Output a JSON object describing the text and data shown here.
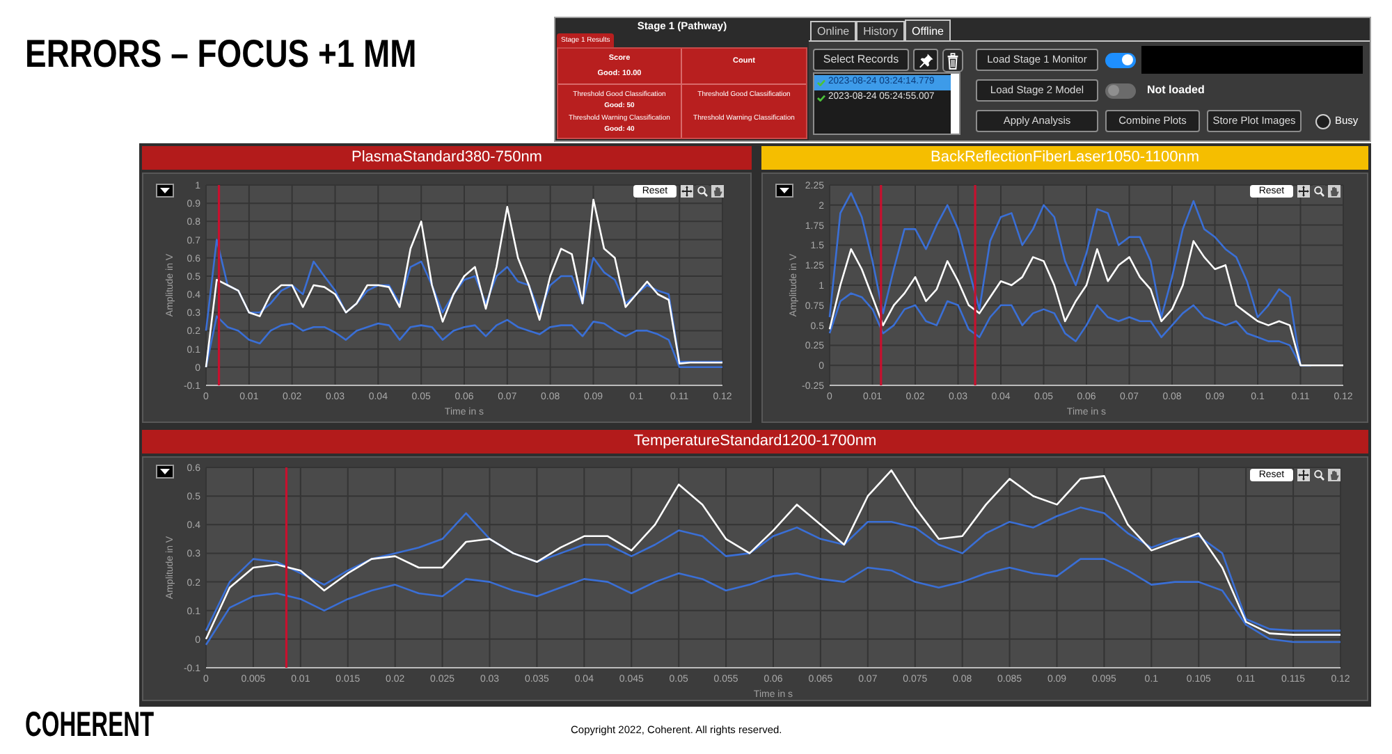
{
  "slide": {
    "title": "ERRORS – FOCUS +1 MM"
  },
  "app": {
    "stage": {
      "title": "Stage 1 (Pathway)",
      "tab": "Stage 1 Results",
      "columns": [
        {
          "heading": "Score",
          "value": "Good: 10.00",
          "thresholds": [
            {
              "label": "Threshold Good Classification",
              "value": "Good: 50"
            },
            {
              "label": "Threshold Warning Classification",
              "value": "Good: 40"
            }
          ]
        },
        {
          "heading": "Count",
          "thresholds": [
            {
              "label": "Threshold Good Classification"
            },
            {
              "label": "Threshold Warning Classification"
            }
          ]
        }
      ]
    },
    "tabs": [
      {
        "label": "Online",
        "selected": false
      },
      {
        "label": "History",
        "selected": false
      },
      {
        "label": "Offline",
        "selected": true
      }
    ],
    "select_records": "Select Records",
    "records": [
      {
        "label": "2023-08-24 03:24:14.779",
        "checked": true,
        "selected": true
      },
      {
        "label": "2023-08-24 05:24:55.007",
        "checked": true,
        "selected": false
      }
    ],
    "rows": [
      {
        "button": "Load Stage 1 Monitor",
        "on": true,
        "kind": "display"
      },
      {
        "button": "Load Stage 2 Model",
        "on": false,
        "kind": "status",
        "status": "Not loaded"
      }
    ],
    "actions": [
      "Apply Analysis",
      "Combine Plots",
      "Store Plot Images"
    ],
    "busy": {
      "label": "Busy",
      "on": false
    }
  },
  "panels": [
    {
      "title": "PlasmaStandard380-750nm",
      "color": "#b31b1b",
      "reset": "Reset",
      "chart_data": {
        "type": "line",
        "xlabel": "Time in s",
        "ylabel": "Amplitude in V",
        "grid": true,
        "xlim": [
          0,
          0.12
        ],
        "ylim": [
          -0.1,
          1
        ],
        "xticks": [
          0,
          0.01,
          0.02,
          0.03,
          0.04,
          0.05,
          0.06,
          0.07,
          0.08,
          0.09,
          0.1,
          0.11,
          0.12
        ],
        "yticks": [
          -0.1,
          0,
          0.1,
          0.2,
          0.3,
          0.4,
          0.5,
          0.6,
          0.7,
          0.8,
          0.9,
          1
        ],
        "x": [
          0,
          0.0025,
          0.005,
          0.0075,
          0.01,
          0.0125,
          0.015,
          0.0175,
          0.02,
          0.0225,
          0.025,
          0.0275,
          0.03,
          0.0325,
          0.035,
          0.0375,
          0.04,
          0.0425,
          0.045,
          0.0475,
          0.05,
          0.0525,
          0.055,
          0.0575,
          0.06,
          0.0625,
          0.065,
          0.0675,
          0.07,
          0.0725,
          0.075,
          0.0775,
          0.08,
          0.0825,
          0.085,
          0.0875,
          0.09,
          0.0925,
          0.095,
          0.0975,
          0.1,
          0.1025,
          0.105,
          0.1075,
          0.11,
          0.1125,
          0.115,
          0.1175,
          0.12
        ],
        "series": [
          {
            "color": "#3a6fd6",
            "values": [
              0.2,
              0.7,
              0.45,
              0.42,
              0.3,
              0.3,
              0.35,
              0.42,
              0.45,
              0.4,
              0.58,
              0.5,
              0.42,
              0.3,
              0.35,
              0.42,
              0.45,
              0.45,
              0.35,
              0.55,
              0.58,
              0.45,
              0.3,
              0.4,
              0.48,
              0.5,
              0.35,
              0.5,
              0.55,
              0.47,
              0.45,
              0.3,
              0.45,
              0.5,
              0.5,
              0.35,
              0.6,
              0.52,
              0.48,
              0.35,
              0.4,
              0.45,
              0.42,
              0.4,
              0.03,
              0.03,
              0.03,
              0.03,
              0.03
            ]
          },
          {
            "color": "#3a6fd6",
            "values": [
              0,
              0.28,
              0.22,
              0.2,
              0.15,
              0.13,
              0.2,
              0.23,
              0.24,
              0.2,
              0.22,
              0.22,
              0.19,
              0.15,
              0.2,
              0.22,
              0.24,
              0.23,
              0.15,
              0.22,
              0.23,
              0.22,
              0.15,
              0.2,
              0.22,
              0.23,
              0.17,
              0.23,
              0.26,
              0.22,
              0.2,
              0.18,
              0.22,
              0.23,
              0.23,
              0.17,
              0.25,
              0.24,
              0.2,
              0.17,
              0.2,
              0.2,
              0.18,
              0.15,
              0,
              0,
              0,
              0,
              0
            ]
          },
          {
            "color": "#ffffff",
            "values": [
              0,
              0.48,
              0.45,
              0.42,
              0.3,
              0.28,
              0.4,
              0.45,
              0.45,
              0.33,
              0.45,
              0.44,
              0.4,
              0.3,
              0.35,
              0.45,
              0.45,
              0.44,
              0.33,
              0.65,
              0.8,
              0.45,
              0.25,
              0.4,
              0.5,
              0.55,
              0.32,
              0.55,
              0.88,
              0.6,
              0.45,
              0.26,
              0.5,
              0.65,
              0.62,
              0.35,
              0.92,
              0.65,
              0.6,
              0.33,
              0.4,
              0.47,
              0.4,
              0.37,
              0.02,
              0.025,
              0.025,
              0.025,
              0.025
            ]
          }
        ],
        "ref_lines": [
          {
            "axis": "x",
            "value": 0.003,
            "color": "#c8102e"
          }
        ]
      }
    },
    {
      "title": "BackReflectionFiberLaser1050-1100nm",
      "color": "#f5be00",
      "reset": "Reset",
      "chart_data": {
        "type": "line",
        "xlabel": "Time in s",
        "ylabel": "Amplitude in V",
        "grid": true,
        "xlim": [
          0,
          0.12
        ],
        "ylim": [
          -0.25,
          2.25
        ],
        "xticks": [
          0,
          0.01,
          0.02,
          0.03,
          0.04,
          0.05,
          0.06,
          0.07,
          0.08,
          0.09,
          0.1,
          0.11,
          0.12
        ],
        "yticks": [
          -0.25,
          0,
          0.25,
          0.5,
          0.75,
          1,
          1.25,
          1.5,
          1.75,
          2,
          2.25
        ],
        "x": [
          0,
          0.0025,
          0.005,
          0.0075,
          0.01,
          0.0125,
          0.015,
          0.0175,
          0.02,
          0.0225,
          0.025,
          0.0275,
          0.03,
          0.0325,
          0.035,
          0.0375,
          0.04,
          0.0425,
          0.045,
          0.0475,
          0.05,
          0.0525,
          0.055,
          0.0575,
          0.06,
          0.0625,
          0.065,
          0.0675,
          0.07,
          0.0725,
          0.075,
          0.0775,
          0.08,
          0.0825,
          0.085,
          0.0875,
          0.09,
          0.0925,
          0.095,
          0.0975,
          0.1,
          0.1025,
          0.105,
          0.1075,
          0.11,
          0.1125,
          0.115,
          0.1175,
          0.12
        ],
        "series": [
          {
            "color": "#3a6fd6",
            "values": [
              0.6,
              1.9,
              2.15,
              1.85,
              1.3,
              0.65,
              1.2,
              1.7,
              1.7,
              1.45,
              1.75,
              2.0,
              1.7,
              1.2,
              0.7,
              1.55,
              1.85,
              1.9,
              1.5,
              1.7,
              2.0,
              1.85,
              1.3,
              1.0,
              1.4,
              1.95,
              1.9,
              1.5,
              1.6,
              1.6,
              1.3,
              0.6,
              1.1,
              1.7,
              2.05,
              1.7,
              1.6,
              1.45,
              1.35,
              1.05,
              0.6,
              0.75,
              0.95,
              0.85,
              0,
              0,
              null,
              null,
              null
            ]
          },
          {
            "color": "#3a6fd6",
            "values": [
              0.4,
              0.8,
              0.9,
              0.85,
              0.7,
              0.4,
              0.5,
              0.7,
              0.75,
              0.55,
              0.5,
              0.8,
              0.75,
              0.45,
              0.35,
              0.6,
              0.75,
              0.75,
              0.5,
              0.65,
              0.7,
              0.65,
              0.4,
              0.3,
              0.5,
              0.75,
              0.6,
              0.55,
              0.6,
              0.55,
              0.55,
              0.35,
              0.5,
              0.65,
              0.75,
              0.6,
              0.55,
              0.5,
              0.55,
              0.4,
              0.35,
              0.3,
              0.3,
              0.25,
              0,
              0,
              null,
              null,
              null
            ]
          },
          {
            "color": "#ffffff",
            "values": [
              0.45,
              1.0,
              1.45,
              1.2,
              0.85,
              0.5,
              0.75,
              0.9,
              1.1,
              0.8,
              0.95,
              1.3,
              1.05,
              0.75,
              0.65,
              0.85,
              1.05,
              1.0,
              1.1,
              1.35,
              1.3,
              1.0,
              0.55,
              0.8,
              1.0,
              1.45,
              1.05,
              1.25,
              1.35,
              1.1,
              0.95,
              0.55,
              0.7,
              1.0,
              1.55,
              1.35,
              1.2,
              1.25,
              0.75,
              0.65,
              0.55,
              0.5,
              0.55,
              0.5,
              0,
              0,
              0,
              0,
              0
            ]
          }
        ],
        "ref_lines": [
          {
            "axis": "x",
            "value": 0.012,
            "color": "#c8102e"
          },
          {
            "axis": "x",
            "value": 0.034,
            "color": "#c8102e"
          }
        ]
      }
    },
    {
      "title": "TemperatureStandard1200-1700nm",
      "color": "#b31b1b",
      "reset": "Reset",
      "chart_data": {
        "type": "line",
        "xlabel": "Time in s",
        "ylabel": "Amplitude in V",
        "grid": true,
        "xlim": [
          0,
          0.12
        ],
        "ylim": [
          -0.1,
          0.6
        ],
        "xticks": [
          0,
          0.005,
          0.01,
          0.015,
          0.02,
          0.025,
          0.03,
          0.035,
          0.04,
          0.045,
          0.05,
          0.055,
          0.06,
          0.065,
          0.07,
          0.075,
          0.08,
          0.085,
          0.09,
          0.095,
          0.1,
          0.105,
          0.11,
          0.115,
          0.12
        ],
        "yticks": [
          -0.1,
          0,
          0.1,
          0.2,
          0.3,
          0.4,
          0.5,
          0.6
        ],
        "x": [
          0,
          0.0025,
          0.005,
          0.0075,
          0.01,
          0.0125,
          0.015,
          0.0175,
          0.02,
          0.0225,
          0.025,
          0.0275,
          0.03,
          0.0325,
          0.035,
          0.0375,
          0.04,
          0.0425,
          0.045,
          0.0475,
          0.05,
          0.0525,
          0.055,
          0.0575,
          0.06,
          0.0625,
          0.065,
          0.0675,
          0.07,
          0.0725,
          0.075,
          0.0775,
          0.08,
          0.0825,
          0.085,
          0.0875,
          0.09,
          0.0925,
          0.095,
          0.0975,
          0.1,
          0.1025,
          0.105,
          0.1075,
          0.11,
          0.1125,
          0.115,
          0.1175,
          0.12
        ],
        "series": [
          {
            "color": "#3a6fd6",
            "values": [
              0.03,
              0.2,
              0.28,
              0.27,
              0.23,
              0.19,
              0.24,
              0.28,
              0.3,
              0.32,
              0.35,
              0.44,
              0.35,
              0.3,
              0.27,
              0.3,
              0.33,
              0.33,
              0.29,
              0.33,
              0.38,
              0.36,
              0.29,
              0.3,
              0.36,
              0.39,
              0.35,
              0.33,
              0.41,
              0.41,
              0.39,
              0.33,
              0.3,
              0.37,
              0.41,
              0.39,
              0.43,
              0.46,
              0.44,
              0.37,
              0.32,
              0.35,
              0.36,
              0.3,
              0.07,
              0.035,
              0.03,
              0.03,
              0.03
            ]
          },
          {
            "color": "#3a6fd6",
            "values": [
              -0.02,
              0.11,
              0.15,
              0.16,
              0.14,
              0.1,
              0.14,
              0.17,
              0.19,
              0.16,
              0.15,
              0.21,
              0.2,
              0.17,
              0.15,
              0.18,
              0.21,
              0.2,
              0.16,
              0.2,
              0.23,
              0.21,
              0.17,
              0.19,
              0.22,
              0.23,
              0.21,
              0.2,
              0.25,
              0.24,
              0.2,
              0.18,
              0.2,
              0.23,
              0.25,
              0.23,
              0.22,
              0.28,
              0.28,
              0.24,
              0.19,
              0.2,
              0.2,
              0.17,
              0.05,
              0,
              -0.01,
              -0.01,
              -0.01
            ]
          },
          {
            "color": "#ffffff",
            "values": [
              0,
              0.18,
              0.25,
              0.26,
              0.24,
              0.17,
              0.23,
              0.28,
              0.29,
              0.25,
              0.25,
              0.34,
              0.35,
              0.3,
              0.27,
              0.32,
              0.36,
              0.36,
              0.31,
              0.4,
              0.54,
              0.47,
              0.35,
              0.3,
              0.38,
              0.47,
              0.4,
              0.33,
              0.5,
              0.59,
              0.46,
              0.35,
              0.36,
              0.47,
              0.56,
              0.5,
              0.47,
              0.56,
              0.57,
              0.4,
              0.31,
              0.34,
              0.37,
              0.25,
              0.06,
              0.02,
              0.015,
              0.015,
              0.015
            ]
          }
        ],
        "ref_lines": [
          {
            "axis": "x",
            "value": 0.0085,
            "color": "#c8102e"
          }
        ]
      }
    }
  ],
  "footer": {
    "logo": "COHERENT",
    "copyright": "Copyright 2022, Coherent. All rights reserved."
  }
}
